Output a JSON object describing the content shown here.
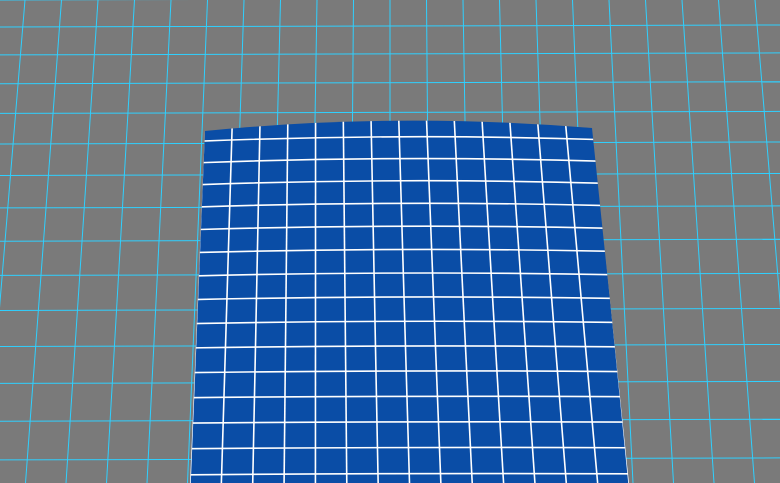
{
  "scene": {
    "background_color": "#7a7a7a",
    "floor_grid_color": "#2fd0ff",
    "sheet_color": "#0a4da6",
    "sheet_grid_color": "#ffffff"
  }
}
